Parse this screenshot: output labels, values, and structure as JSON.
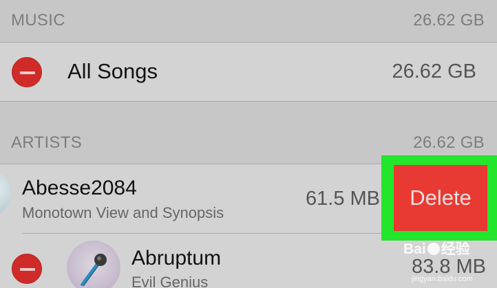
{
  "music_section": {
    "title": "MUSIC",
    "size": "26.62 GB"
  },
  "all_songs": {
    "label": "All Songs",
    "size": "26.62 GB"
  },
  "artists_section": {
    "title": "ARTISTS",
    "size": "26.62 GB"
  },
  "artists": [
    {
      "name": "Abesse2084",
      "subtitle": "Monotown View and Synopsis",
      "size": "61.5 MB",
      "swipe_action": "Delete"
    },
    {
      "name": "Abruptum",
      "subtitle": "Evil Genius",
      "size": "83.8 MB"
    }
  ],
  "watermark": {
    "brand_left": "Bai",
    "brand_right": "经验",
    "url": "jingyan.baidu.com"
  },
  "colors": {
    "delete_red": "#e83a33",
    "highlight_green": "#22e52c",
    "minus_red": "#cf2b29"
  }
}
